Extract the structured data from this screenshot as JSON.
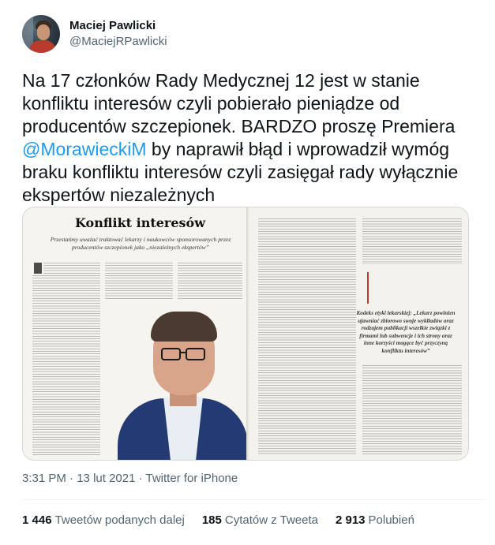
{
  "author": {
    "display_name": "Maciej Pawlicki",
    "handle": "@MaciejRPawlicki"
  },
  "tweet": {
    "text_before": "Na 17 członków Rady Medycznej 12 jest w stanie konfliktu interesów  czyli pobierało pieniądze od producentów szczepionek. BARDZO proszę Premiera ",
    "mention": "@MorawieckiM",
    "text_after": " by naprawił błąd i wprowadził wymóg braku konfliktu interesów czyli zasięgał rady wyłącznie ekspertów niezależnych"
  },
  "media": {
    "article_title": "Konflikt interesów",
    "article_lead": "Przestańmy uważać traktować lekarzy i naukowców sponsorowanych przez producentów szczepionek jako „niezależnych ekspertów”",
    "pull_quote": "Kodeks etyki lekarskiej: „Lekarz powinien ujawniać zbiorowo swoje wyklładów oraz rodzajem publikacji wszelkie związki z firmami lub subwencje i ich strony oraz inne korzyści mogące być przyczyną konfliktu interesów”"
  },
  "meta": {
    "time": "3:31 PM",
    "separator": " · ",
    "date": "13 lut 2021",
    "source": "Twitter for iPhone"
  },
  "stats": {
    "retweets_count": "1 446",
    "retweets_label": "Tweetów podanych dalej",
    "quotes_count": "185",
    "quotes_label": "Cytatów z Tweeta",
    "likes_count": "2 913",
    "likes_label": "Polubień"
  }
}
